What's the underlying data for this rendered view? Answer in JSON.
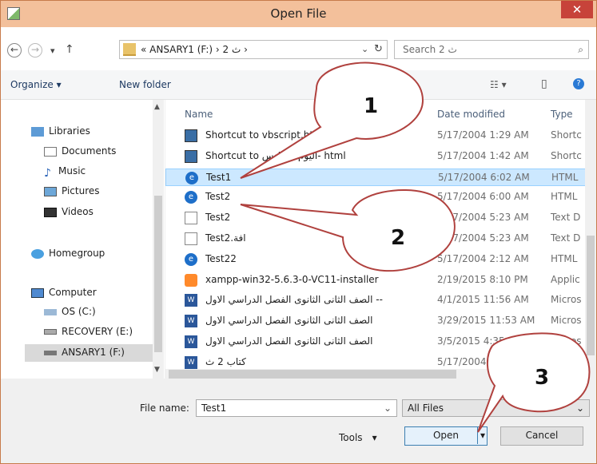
{
  "window": {
    "title": "Open File",
    "close_label": "✕"
  },
  "nav": {
    "back": "←",
    "forward": "→",
    "recent": "▾",
    "up": "↑",
    "refresh": "↻"
  },
  "address": {
    "path": "« ANSARY1 (F:)  ›  ث 2  ›",
    "dropdown": "⌄"
  },
  "search": {
    "placeholder": "Search ث 2",
    "icon": "⌕"
  },
  "toolbar": {
    "organize": "Organize ▾",
    "new_folder": "New folder",
    "view": "☷ ▾",
    "preview": "▯",
    "help": "?"
  },
  "sidebar": {
    "items": [
      {
        "label": "Libraries",
        "icon": "library-icon"
      },
      {
        "label": "Documents",
        "icon": "documents-icon"
      },
      {
        "label": "Music",
        "icon": "music-icon"
      },
      {
        "label": "Pictures",
        "icon": "pictures-icon"
      },
      {
        "label": "Videos",
        "icon": "videos-icon"
      },
      {
        "label": "Homegroup",
        "icon": "homegroup-icon"
      },
      {
        "label": "Computer",
        "icon": "computer-icon"
      },
      {
        "label": "OS (C:)",
        "icon": "drive-icon"
      },
      {
        "label": "RECOVERY (E:)",
        "icon": "drive-icon"
      },
      {
        "label": "ANSARY1 (F:)",
        "icon": "drive-icon"
      }
    ]
  },
  "files": {
    "headers": {
      "name": "Name",
      "date": "Date modified",
      "type": "Type"
    },
    "rows": [
      {
        "name": "Shortcut to vbscript.html",
        "date": "5/17/2004 1:29 AM",
        "type": "Shortc",
        "icon": "shortcut"
      },
      {
        "name": "Shortcut to اليوم السادس- html",
        "date": "5/17/2004 1:42 AM",
        "type": "Shortc",
        "icon": "shortcut"
      },
      {
        "name": "Test1",
        "date": "5/17/2004 6:02 AM",
        "type": "HTML",
        "icon": "html"
      },
      {
        "name": "Test2",
        "date": "5/17/2004 6:00 AM",
        "type": "HTML",
        "icon": "html"
      },
      {
        "name": "Test2",
        "date": "5/17/2004 5:23 AM",
        "type": "Text D",
        "icon": "text"
      },
      {
        "name": "Test2.افة",
        "date": "5/17/2004 5:23 AM",
        "type": "Text D",
        "icon": "text"
      },
      {
        "name": "Test22",
        "date": "5/17/2004 2:12 AM",
        "type": "HTML",
        "icon": "html"
      },
      {
        "name": "xampp-win32-5.6.3-0-VC11-installer",
        "date": "2/19/2015 8:10 PM",
        "type": "Applic",
        "icon": "app"
      },
      {
        "name": "الصف الثانى الثانوى الفصل الدراسي الاول --",
        "date": "4/1/2015 11:56 AM",
        "type": "Micros",
        "icon": "word"
      },
      {
        "name": "الصف الثانى الثانوى الفصل الدراسي الاول",
        "date": "3/29/2015 11:53 AM",
        "type": "Micros",
        "icon": "word"
      },
      {
        "name": "الصف الثانى الثانوى الفصل الدراسي الاول",
        "date": "3/5/2015 4:35 AM",
        "type": "Micros",
        "icon": "word"
      },
      {
        "name": "كتاب 2 ث",
        "date": "5/17/2004",
        "type": "",
        "icon": "word"
      }
    ]
  },
  "footer": {
    "filename_label": "File name:",
    "filename_value": "Test1",
    "filetype_value": "All Files",
    "tools_label": "Tools",
    "open_label": "Open",
    "cancel_label": "Cancel"
  },
  "callouts": [
    "1",
    "2",
    "3"
  ]
}
